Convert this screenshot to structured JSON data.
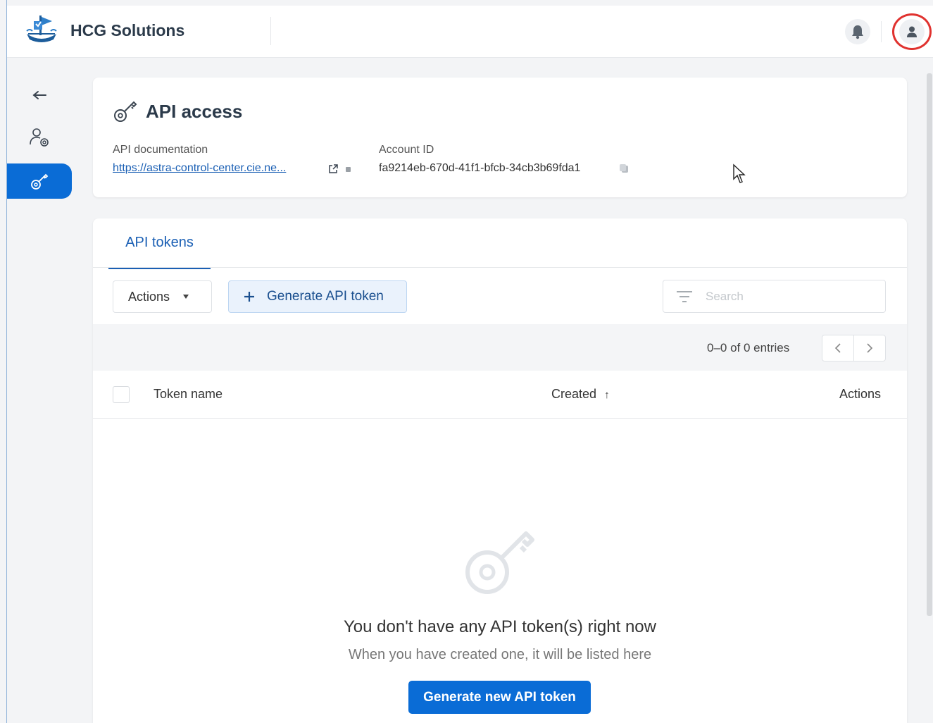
{
  "header": {
    "brand": "HCG Solutions",
    "icons": [
      "ship-logo-icon",
      "bell-icon",
      "user-icon"
    ],
    "highlight_color": "#e0322f"
  },
  "sidebar": {
    "items": [
      {
        "icon": "back-arrow-icon",
        "active": false
      },
      {
        "icon": "account-settings-icon",
        "active": false
      },
      {
        "icon": "key-icon",
        "active": true
      }
    ],
    "active_color": "#0a6cd6"
  },
  "api_access": {
    "title": "API access",
    "doc_label": "API documentation",
    "doc_link": "https://astra-control-center.cie.ne...",
    "account_label": "Account ID",
    "account_id": "fa9214eb-670d-41f1-bfcb-34cb3b69fda1"
  },
  "tokens": {
    "tab_label": "API tokens",
    "actions_label": "Actions",
    "generate_label": "Generate API token",
    "search_placeholder": "Search",
    "entries": "0–0 of 0 entries",
    "columns": [
      "Token name",
      "Created",
      "Actions"
    ],
    "sort_indicator": "↑",
    "empty_title": "You don't have any API token(s) right now",
    "empty_subtitle": "When you have created one, it will be listed here",
    "empty_button": "Generate new API token"
  }
}
